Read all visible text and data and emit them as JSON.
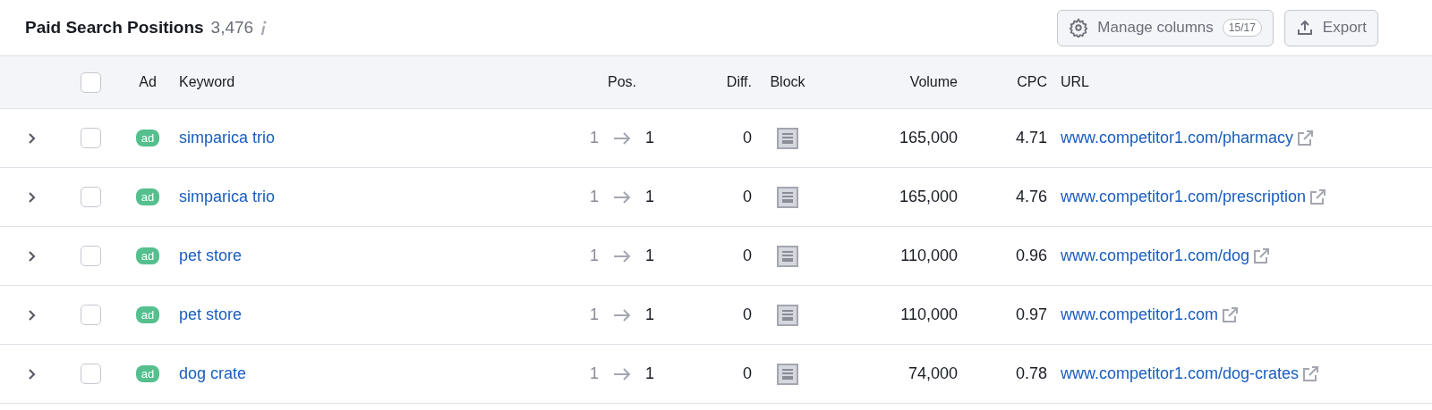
{
  "header": {
    "title": "Paid Search Positions",
    "count": "3,476",
    "manage_columns": {
      "label": "Manage columns",
      "badge": "15/17"
    },
    "export": {
      "label": "Export"
    }
  },
  "table": {
    "select_all": {
      "checked": false
    },
    "columns": [
      "Ad",
      "Keyword",
      "Pos.",
      "Diff.",
      "Block",
      "Volume",
      "CPC",
      "URL"
    ],
    "rows": [
      {
        "expanded": false,
        "checked": false,
        "ad": "ad",
        "keyword": "simparica trio",
        "pos_previous": "1",
        "pos_current": "1",
        "diff": "0",
        "volume": "165,000",
        "cpc": "4.71",
        "url": "www.competitor1.com/pharmacy"
      },
      {
        "expanded": false,
        "checked": false,
        "ad": "ad",
        "keyword": "simparica trio",
        "pos_previous": "1",
        "pos_current": "1",
        "diff": "0",
        "volume": "165,000",
        "cpc": "4.76",
        "url": "www.competitor1.com/prescription"
      },
      {
        "expanded": false,
        "checked": false,
        "ad": "ad",
        "keyword": "pet store",
        "pos_previous": "1",
        "pos_current": "1",
        "diff": "0",
        "volume": "110,000",
        "cpc": "0.96",
        "url": "www.competitor1.com/dog"
      },
      {
        "expanded": false,
        "checked": false,
        "ad": "ad",
        "keyword": "pet store",
        "pos_previous": "1",
        "pos_current": "1",
        "diff": "0",
        "volume": "110,000",
        "cpc": "0.97",
        "url": "www.competitor1.com"
      },
      {
        "expanded": false,
        "checked": false,
        "ad": "ad",
        "keyword": "dog crate",
        "pos_previous": "1",
        "pos_current": "1",
        "diff": "0",
        "volume": "74,000",
        "cpc": "0.78",
        "url": "www.competitor1.com/dog-crates"
      }
    ]
  }
}
